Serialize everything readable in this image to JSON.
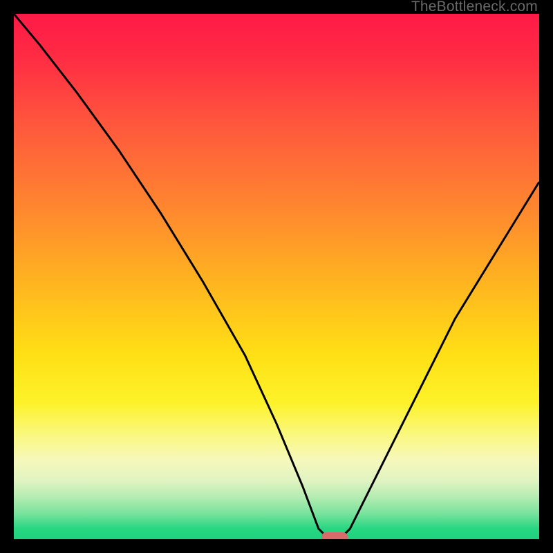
{
  "watermark": "TheBottleneck.com",
  "colors": {
    "curve_stroke": "#000000",
    "marker_fill": "#d96b6b"
  },
  "chart_data": {
    "type": "line",
    "xlim": [
      0,
      100
    ],
    "ylim": [
      0,
      100
    ],
    "title": "",
    "xlabel": "",
    "ylabel": "",
    "series": [
      {
        "name": "bottleneck-curve",
        "x": [
          0,
          5,
          12,
          20,
          28,
          36,
          44,
          50,
          55,
          58,
          60,
          62,
          64,
          68,
          76,
          84,
          92,
          100
        ],
        "values": [
          100,
          94,
          85,
          74,
          62,
          49,
          35,
          22,
          10,
          2,
          0,
          0,
          2,
          10,
          26,
          42,
          55,
          68
        ]
      }
    ],
    "marker": {
      "x": 61,
      "width_pct": 5
    }
  }
}
